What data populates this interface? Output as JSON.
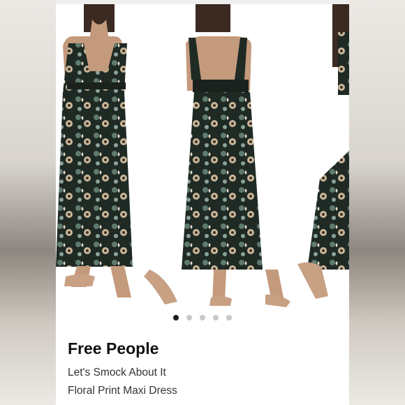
{
  "listing": {
    "brand": "Free People",
    "title_line1": "Let's Smock About It",
    "title_line2": "Floral Print Maxi Dress"
  },
  "carousel": {
    "total_images": 5,
    "active_index": 0
  },
  "colors": {
    "dress_dark": "#1f2a24",
    "dress_print_light": "#cbb79a",
    "dress_print_teal": "#5f7a6f",
    "skin": "#c49a7c",
    "sandal": "#c8a083",
    "dot_active": "#1c1c1c",
    "dot_inactive": "#c8c8c8"
  }
}
